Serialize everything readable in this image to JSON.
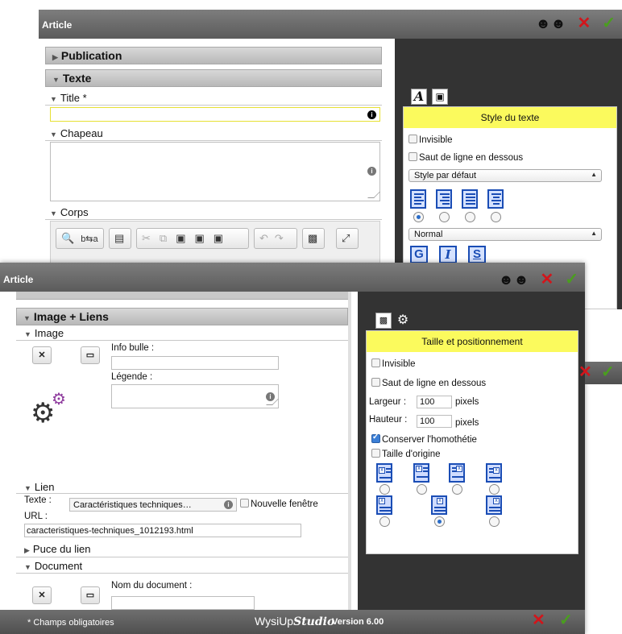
{
  "back_window": {
    "title": "Article",
    "sections": {
      "publication": "Publication",
      "texte": "Texte",
      "title_field": "Title *",
      "chapeau": "Chapeau",
      "corps": "Corps"
    },
    "style_panel": {
      "header": "Style du texte",
      "invisible": "Invisible",
      "saut": "Saut de ligne en dessous",
      "style_select": "Style par défaut",
      "format_select": "Normal",
      "tab_a": "A",
      "format_buttons": [
        "G",
        "I",
        "S"
      ],
      "align_selected": 0
    }
  },
  "front_window": {
    "title": "Article",
    "section_title": "Image + Liens",
    "image": {
      "heading": "Image",
      "info_bulle_label": "Info bulle :",
      "legende_label": "Légende :"
    },
    "lien": {
      "heading": "Lien",
      "texte_label": "Texte :",
      "texte_value": "Caractéristiques techniques…",
      "nouvelle_fenetre": "Nouvelle fenêtre",
      "url_label": "URL :",
      "url_value": "caracteristiques-techniques_1012193.html"
    },
    "puce": "Puce du lien",
    "document": {
      "heading": "Document",
      "nom_label": "Nom du document :"
    },
    "footer": {
      "required_note": "* Champs obligatoires",
      "brand_prefix": "WysiUp",
      "brand_suffix": "Studio",
      "version": "Version 6.00"
    },
    "size_panel": {
      "header": "Taille et positionnement",
      "invisible": "Invisible",
      "saut": "Saut de ligne en dessous",
      "largeur_label": "Largeur :",
      "largeur_value": "100",
      "hauteur_label": "Hauteur :",
      "hauteur_value": "100",
      "unit": "pixels",
      "conserver": "Conserver l'homothétie",
      "conserver_checked": true,
      "taille_origine": "Taille d'origine",
      "position_selected": 5
    }
  },
  "colors": {
    "titlebar": "#666666",
    "panel_header": "#fbfa5d",
    "dark_area": "#333333",
    "close_red": "#d2151b",
    "ok_green": "#4a9e1e",
    "icon_blue": "#1a4db5",
    "gear_purple": "#8e3a9d"
  }
}
